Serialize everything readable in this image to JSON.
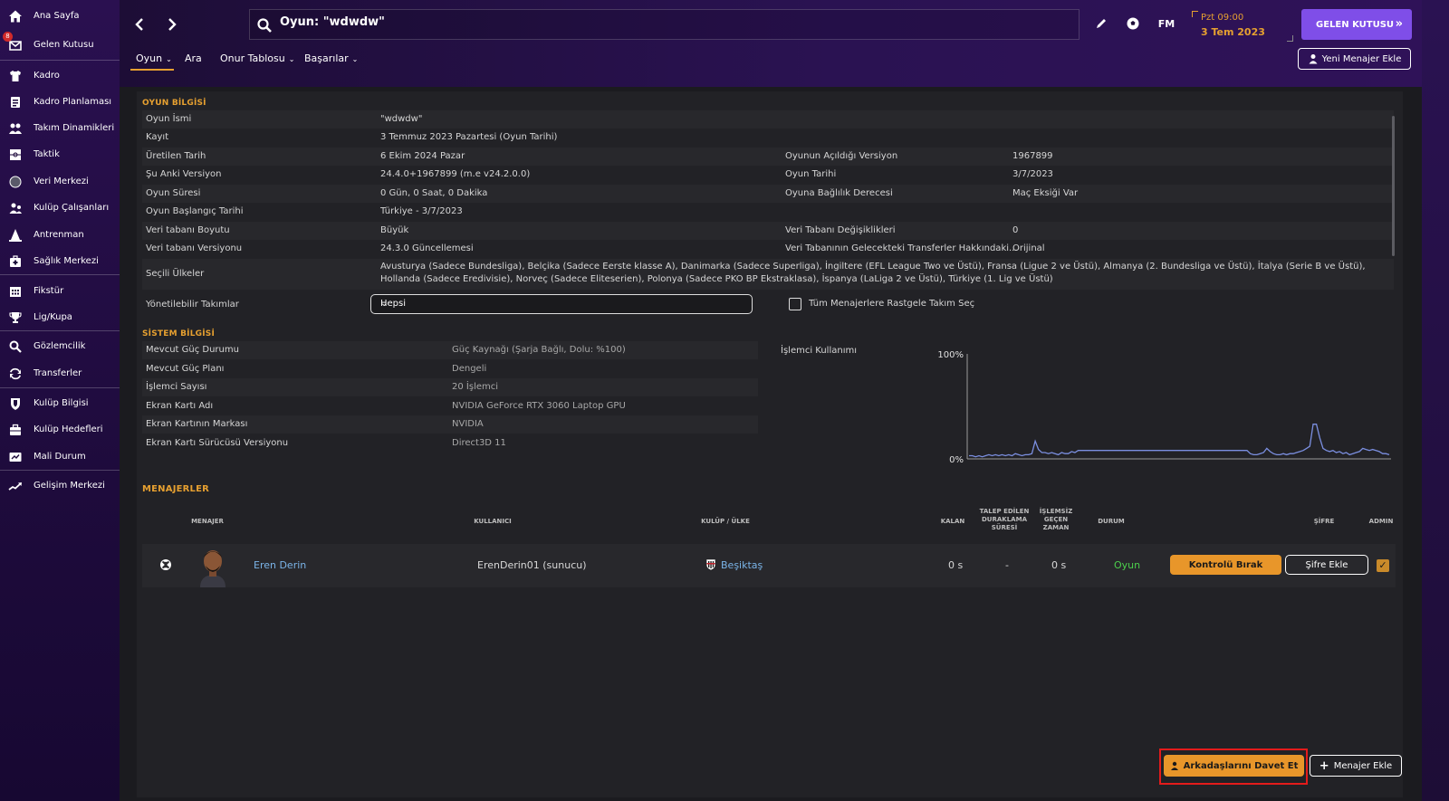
{
  "sidebar": {
    "items": [
      {
        "label": "Ana Sayfa",
        "icon": "home-icon"
      },
      {
        "label": "Gelen Kutusu",
        "icon": "inbox-icon",
        "badge": "8"
      },
      {
        "label": "Kadro",
        "icon": "squad-shirt-icon"
      },
      {
        "label": "Kadro Planlaması",
        "icon": "squad-planner-icon"
      },
      {
        "label": "Takım Dinamikleri",
        "icon": "team-dynamics-icon"
      },
      {
        "label": "Taktik",
        "icon": "tactics-board-icon"
      },
      {
        "label": "Veri Merkezi",
        "icon": "data-hub-icon"
      },
      {
        "label": "Kulüp Çalışanları",
        "icon": "staff-icon"
      },
      {
        "label": "Antrenman",
        "icon": "training-cone-icon"
      },
      {
        "label": "Sağlık Merkezi",
        "icon": "medical-icon"
      },
      {
        "label": "Fikstür",
        "icon": "calendar-icon"
      },
      {
        "label": "Lig/Kupa",
        "icon": "trophy-icon"
      },
      {
        "label": "Gözlemcilik",
        "icon": "scouting-magnifier-icon"
      },
      {
        "label": "Transferler",
        "icon": "transfers-arrows-icon"
      },
      {
        "label": "Kulüp Bilgisi",
        "icon": "club-shield-icon"
      },
      {
        "label": "Kulüp Hedefleri",
        "icon": "club-vision-icon"
      },
      {
        "label": "Mali Durum",
        "icon": "finances-icon"
      },
      {
        "label": "Gelişim Merkezi",
        "icon": "development-centre-icon"
      }
    ]
  },
  "topbar": {
    "search_title": "Oyun: \"wdwdw\"",
    "fm_logo": "FM",
    "date_time": "Pzt 09:00",
    "date_day": "3 Tem 2023",
    "inbox_button": "GELEN KUTUSU",
    "tabs": [
      "Oyun",
      "Ara",
      "Onur Tablosu",
      "Başarılar"
    ],
    "new_manager_button": "Yeni Menajer Ekle"
  },
  "game_info": {
    "title": "OYUN BİLGİSİ",
    "rows": [
      {
        "k1": "Oyun İsmi",
        "v1": "\"wdwdw\"",
        "k2": "",
        "v2": ""
      },
      {
        "k1": "Kayıt",
        "v1": "3 Temmuz 2023 Pazartesi (Oyun Tarihi)",
        "k2": "",
        "v2": ""
      },
      {
        "k1": "Üretilen Tarih",
        "v1": "6 Ekim 2024 Pazar",
        "k2": "Oyunun Açıldığı Versiyon",
        "v2": "1967899"
      },
      {
        "k1": "Şu Anki Versiyon",
        "v1": "24.4.0+1967899 (m.e v24.2.0.0)",
        "k2": "Oyun Tarihi",
        "v2": "3/7/2023"
      },
      {
        "k1": "Oyun Süresi",
        "v1": "0 Gün, 0 Saat, 0 Dakika",
        "k2": "Oyuna Bağlılık Derecesi",
        "v2": "Maç Eksiği Var"
      },
      {
        "k1": "Oyun Başlangıç Tarihi",
        "v1": "Türkiye - 3/7/2023",
        "k2": "",
        "v2": ""
      },
      {
        "k1": "Veri tabanı Boyutu",
        "v1": "Büyük",
        "k2": "Veri Tabanı Değişiklikleri",
        "v2": "0"
      },
      {
        "k1": "Veri tabanı Versiyonu",
        "v1": "24.3.0 Güncellemesi",
        "k2": "Veri Tabanının Gelecekteki Transferler Hakkındaki...",
        "v2": "Orijinal"
      }
    ],
    "countries_label": "Seçili Ülkeler",
    "countries_value": "Avusturya (Sadece Bundesliga), Belçika (Sadece Eerste klasse A), Danimarka (Sadece Superliga), İngiltere (EFL League Two ve Üstü), Fransa (Ligue 2 ve Üstü), Almanya (2. Bundesliga ve Üstü), İtalya (Serie B ve Üstü), Hollanda (Sadece Eredivisie), Norveç (Sadece Eliteserien), Polonya (Sadece PKO BP Ekstraklasa), İspanya (LaLiga 2 ve Üstü), Türkiye (1. Lig ve Üstü)",
    "teams_label": "Yönetilebilir Takımlar",
    "teams_select_value": "Hepsi",
    "random_team_label": "Tüm Menajerlere Rastgele Takım Seç",
    "random_team_checked": false
  },
  "system_info": {
    "title": "SİSTEM BİLGİSİ",
    "rows": [
      {
        "k": "Mevcut Güç Durumu",
        "v": "Güç Kaynağı (Şarja Bağlı, Dolu: %100)"
      },
      {
        "k": "Mevcut Güç Planı",
        "v": "Dengeli"
      },
      {
        "k": "İşlemci Sayısı",
        "v": "20 İşlemci"
      },
      {
        "k": "Ekran Kartı Adı",
        "v": "NVIDIA GeForce RTX 3060 Laptop GPU"
      },
      {
        "k": "Ekran Kartının Markası",
        "v": "NVIDIA"
      },
      {
        "k": "Ekran Kartı Sürücüsü Versiyonu",
        "v": "Direct3D 11"
      }
    ],
    "cpu_label": "İşlemci Kullanımı"
  },
  "chart_data": {
    "type": "line",
    "title": "İşlemci Kullanımı",
    "ylim": [
      0,
      100
    ],
    "yticks": [
      "100%",
      "0%"
    ],
    "grid": false,
    "color": "#7b8fe0",
    "series": [
      {
        "values": [
          3,
          3,
          2,
          3,
          2,
          3,
          4,
          3,
          4,
          3,
          4,
          3,
          4,
          3,
          5,
          4,
          3,
          4,
          4,
          5,
          17,
          9,
          6,
          6,
          5,
          6,
          5,
          4,
          6,
          5,
          5,
          7,
          6,
          8,
          8,
          8,
          8,
          8,
          8,
          8,
          8,
          8,
          8,
          8,
          8,
          8,
          8,
          8,
          8,
          8,
          8,
          8,
          8,
          8,
          8,
          8,
          8,
          8,
          8,
          8,
          8,
          8,
          8,
          8,
          8,
          8,
          8,
          8,
          8,
          8,
          8,
          8,
          8,
          8,
          8,
          8,
          8,
          8,
          8,
          8,
          8,
          8,
          8,
          8,
          8,
          5,
          4,
          4,
          5,
          6,
          10,
          7,
          5,
          4,
          4,
          5,
          4,
          5,
          5,
          6,
          7,
          8,
          10,
          12,
          33,
          33,
          20,
          10,
          8,
          7,
          8,
          6,
          7,
          5,
          6,
          4,
          5,
          6,
          7,
          10,
          9,
          8,
          9,
          8,
          7,
          5,
          5,
          4
        ]
      }
    ]
  },
  "managers": {
    "title": "MENAJERLER",
    "columns": {
      "manager": "MENAJER",
      "user": "KULLANICI",
      "club": "KULÜP / ÜLKE",
      "remaining": "KALAN",
      "pause": "TALEP EDİLEN DURAKLAMA SÜRESİ",
      "idle": "İŞLEMSİZ GEÇEN ZAMAN",
      "status": "DURUM",
      "password": "ŞİFRE",
      "admin": "ADMIN"
    },
    "rows": [
      {
        "platform_icon": "xbox-icon",
        "name": "Eren Derin",
        "user": "ErenDerin01 (sunucu)",
        "club": "Beşiktaş",
        "remaining": "0 s",
        "pause": "-",
        "idle": "0 s",
        "status": "Oyun",
        "control_button": "Kontrolü Bırak",
        "password_button": "Şifre Ekle",
        "admin": true
      }
    ],
    "invite_button": "Arkadaşlarını Davet Et",
    "add_manager_button": "Menajer Ekle"
  },
  "colors": {
    "accent": "#e6a030",
    "inbox_button": "#7f4ee8",
    "status_online": "#4ccf4c",
    "link": "#7ab4e8",
    "highlight_box": "#e31b1b"
  }
}
